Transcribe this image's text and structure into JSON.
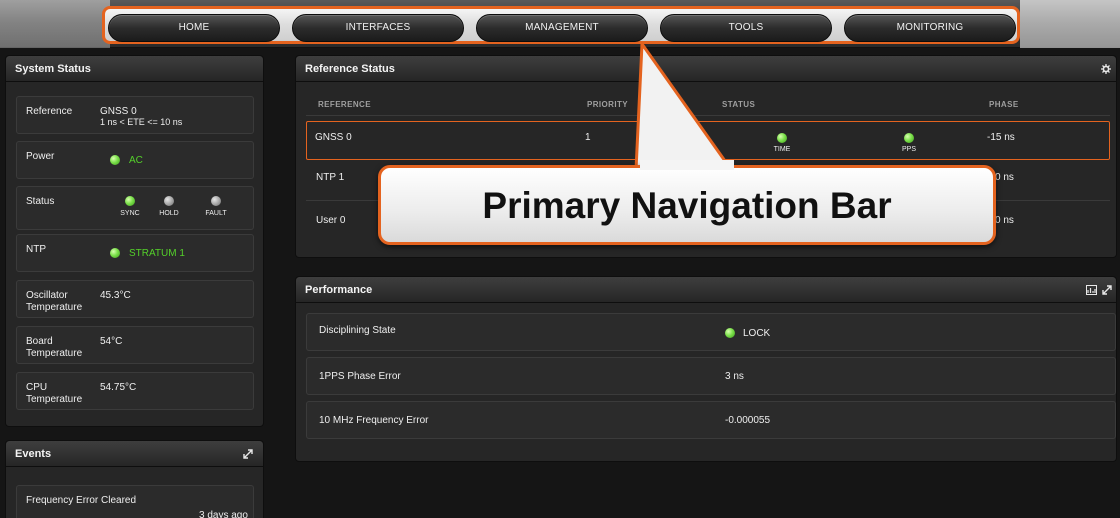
{
  "nav": {
    "items": [
      {
        "label": "HOME"
      },
      {
        "label": "INTERFACES"
      },
      {
        "label": "MANAGEMENT"
      },
      {
        "label": "TOOLS"
      },
      {
        "label": "MONITORING"
      }
    ]
  },
  "colors": {
    "accent": "#e4631f",
    "led_on": "#54d02a",
    "led_off": "#a8a8a8",
    "panel": "#262626",
    "background": "#151515"
  },
  "system_status": {
    "title": "System Status",
    "reference": {
      "label": "Reference",
      "value": "GNSS 0",
      "detail": "1 ns < ETE <= 10 ns"
    },
    "power": {
      "label": "Power",
      "value": "AC"
    },
    "status": {
      "label": "Status",
      "indicators": [
        {
          "caption": "SYNC",
          "state": "on"
        },
        {
          "caption": "HOLD",
          "state": "off"
        },
        {
          "caption": "FAULT",
          "state": "off"
        }
      ]
    },
    "ntp": {
      "label": "NTP",
      "value": "STRATUM 1"
    },
    "oscillator": {
      "label": "Oscillator Temperature",
      "value": "45.3°C"
    },
    "board": {
      "label": "Board Temperature",
      "value": "54°C"
    },
    "cpu": {
      "label": "CPU Temperature",
      "value": "54.75°C"
    }
  },
  "events": {
    "title": "Events",
    "items": [
      {
        "text": "Frequency Error Cleared",
        "time": "3 days ago"
      }
    ]
  },
  "reference_status": {
    "title": "Reference Status",
    "columns": [
      "REFERENCE",
      "PRIORITY",
      "STATUS",
      "PHASE"
    ],
    "rows": [
      {
        "reference": "GNSS 0",
        "priority": "1",
        "time_caption": "TIME",
        "pps_caption": "PPS",
        "phase": "-15 ns"
      },
      {
        "reference": "NTP 1",
        "priority": "",
        "phase": "0 ns"
      },
      {
        "reference": "User 0",
        "priority": "",
        "phase": "0 ns"
      }
    ]
  },
  "performance": {
    "title": "Performance",
    "rows": [
      {
        "label": "Disciplining State",
        "value": "LOCK"
      },
      {
        "label": "1PPS Phase Error",
        "value": "3 ns"
      },
      {
        "label": "10 MHz Frequency Error",
        "value": "-0.000055"
      }
    ]
  },
  "callout": {
    "text": "Primary Navigation Bar"
  }
}
